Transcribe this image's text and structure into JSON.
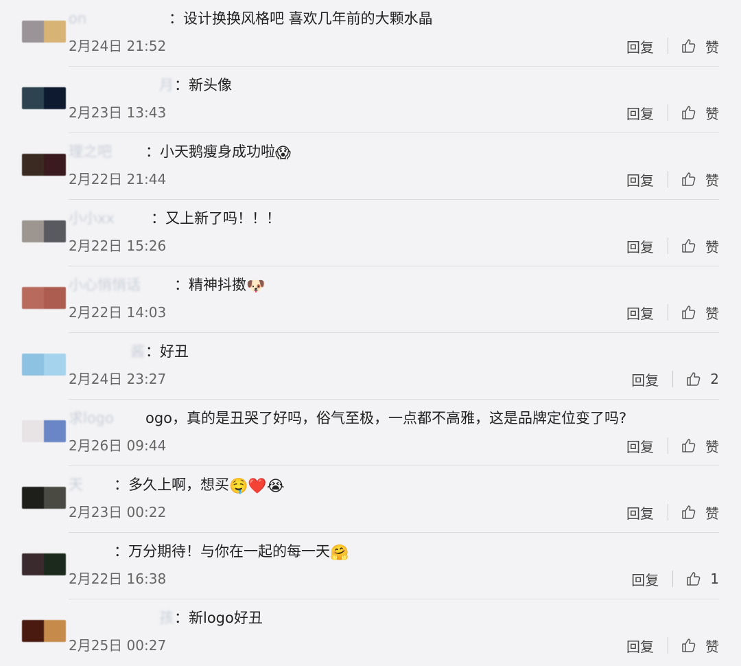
{
  "comments": [
    {
      "name": "on",
      "sep": "：",
      "text": "设计换换风格吧 喜欢几年前的大颗水晶",
      "emoji": [],
      "time": "2月24日 21:52",
      "reply": "回复",
      "like": "赞",
      "avatar": [
        "#9a9498",
        "#d7b476"
      ]
    },
    {
      "name": "月",
      "sep": "：",
      "text": "新头像",
      "emoji": [],
      "time": "2月23日 13:43",
      "reply": "回复",
      "like": "赞",
      "avatar": [
        "#2d4450",
        "#0e1a30"
      ]
    },
    {
      "name": "理之吧",
      "sep": "：",
      "text": "小天鹅瘦身成功啦",
      "emoji": [
        "😱"
      ],
      "time": "2月22日 21:44",
      "reply": "回复",
      "like": "赞",
      "avatar": [
        "#3a2a22",
        "#3a1a1e"
      ]
    },
    {
      "name": "小小xx",
      "sep": "：",
      "text": "又上新了吗！！！",
      "emoji": [],
      "time": "2月22日 15:26",
      "reply": "回复",
      "like": "赞",
      "avatar": [
        "#9c9590",
        "#585a60"
      ]
    },
    {
      "name": "小心悄悄话",
      "sep": "：",
      "text": "精神抖擞",
      "emoji": [
        "🐶"
      ],
      "time": "2月22日 14:03",
      "reply": "回复",
      "like": "赞",
      "avatar": [
        "#b86a5c",
        "#ad5c50"
      ]
    },
    {
      "name": "酱",
      "sep": "：",
      "text": "好丑",
      "emoji": [],
      "time": "2月24日 23:27",
      "reply": "回复",
      "like": "2",
      "avatar": [
        "#8dc2e2",
        "#a5d2ec"
      ]
    },
    {
      "name": "求logo",
      "sep": "",
      "text": "ogo，真的是丑哭了好吗，俗气至极，一点都不高雅，这是品牌定位变了吗?",
      "emoji": [],
      "time": "2月26日 09:44",
      "reply": "回复",
      "like": "赞",
      "avatar": [
        "#e8e4e6",
        "#6a86c6"
      ]
    },
    {
      "name": "天",
      "sep": "：",
      "text": "多久上啊，想买",
      "emoji": [
        "🤤",
        "❤️",
        "😭"
      ],
      "time": "2月23日 00:22",
      "reply": "回复",
      "like": "赞",
      "avatar": [
        "#1e1e1a",
        "#4a4a42"
      ]
    },
    {
      "name": "",
      "sep": "：",
      "text": "万分期待！与你在一起的每一天",
      "emoji": [
        "🤗"
      ],
      "time": "2月22日 16:38",
      "reply": "回复",
      "like": "1",
      "avatar": [
        "#3a2a2e",
        "#1c2a1e"
      ]
    },
    {
      "name": "孩",
      "sep": "：",
      "text": "新logo好丑",
      "emoji": [],
      "time": "2月25日 00:27",
      "reply": "回复",
      "like": "赞",
      "avatar": [
        "#4a1a10",
        "#c68a4a"
      ]
    }
  ]
}
